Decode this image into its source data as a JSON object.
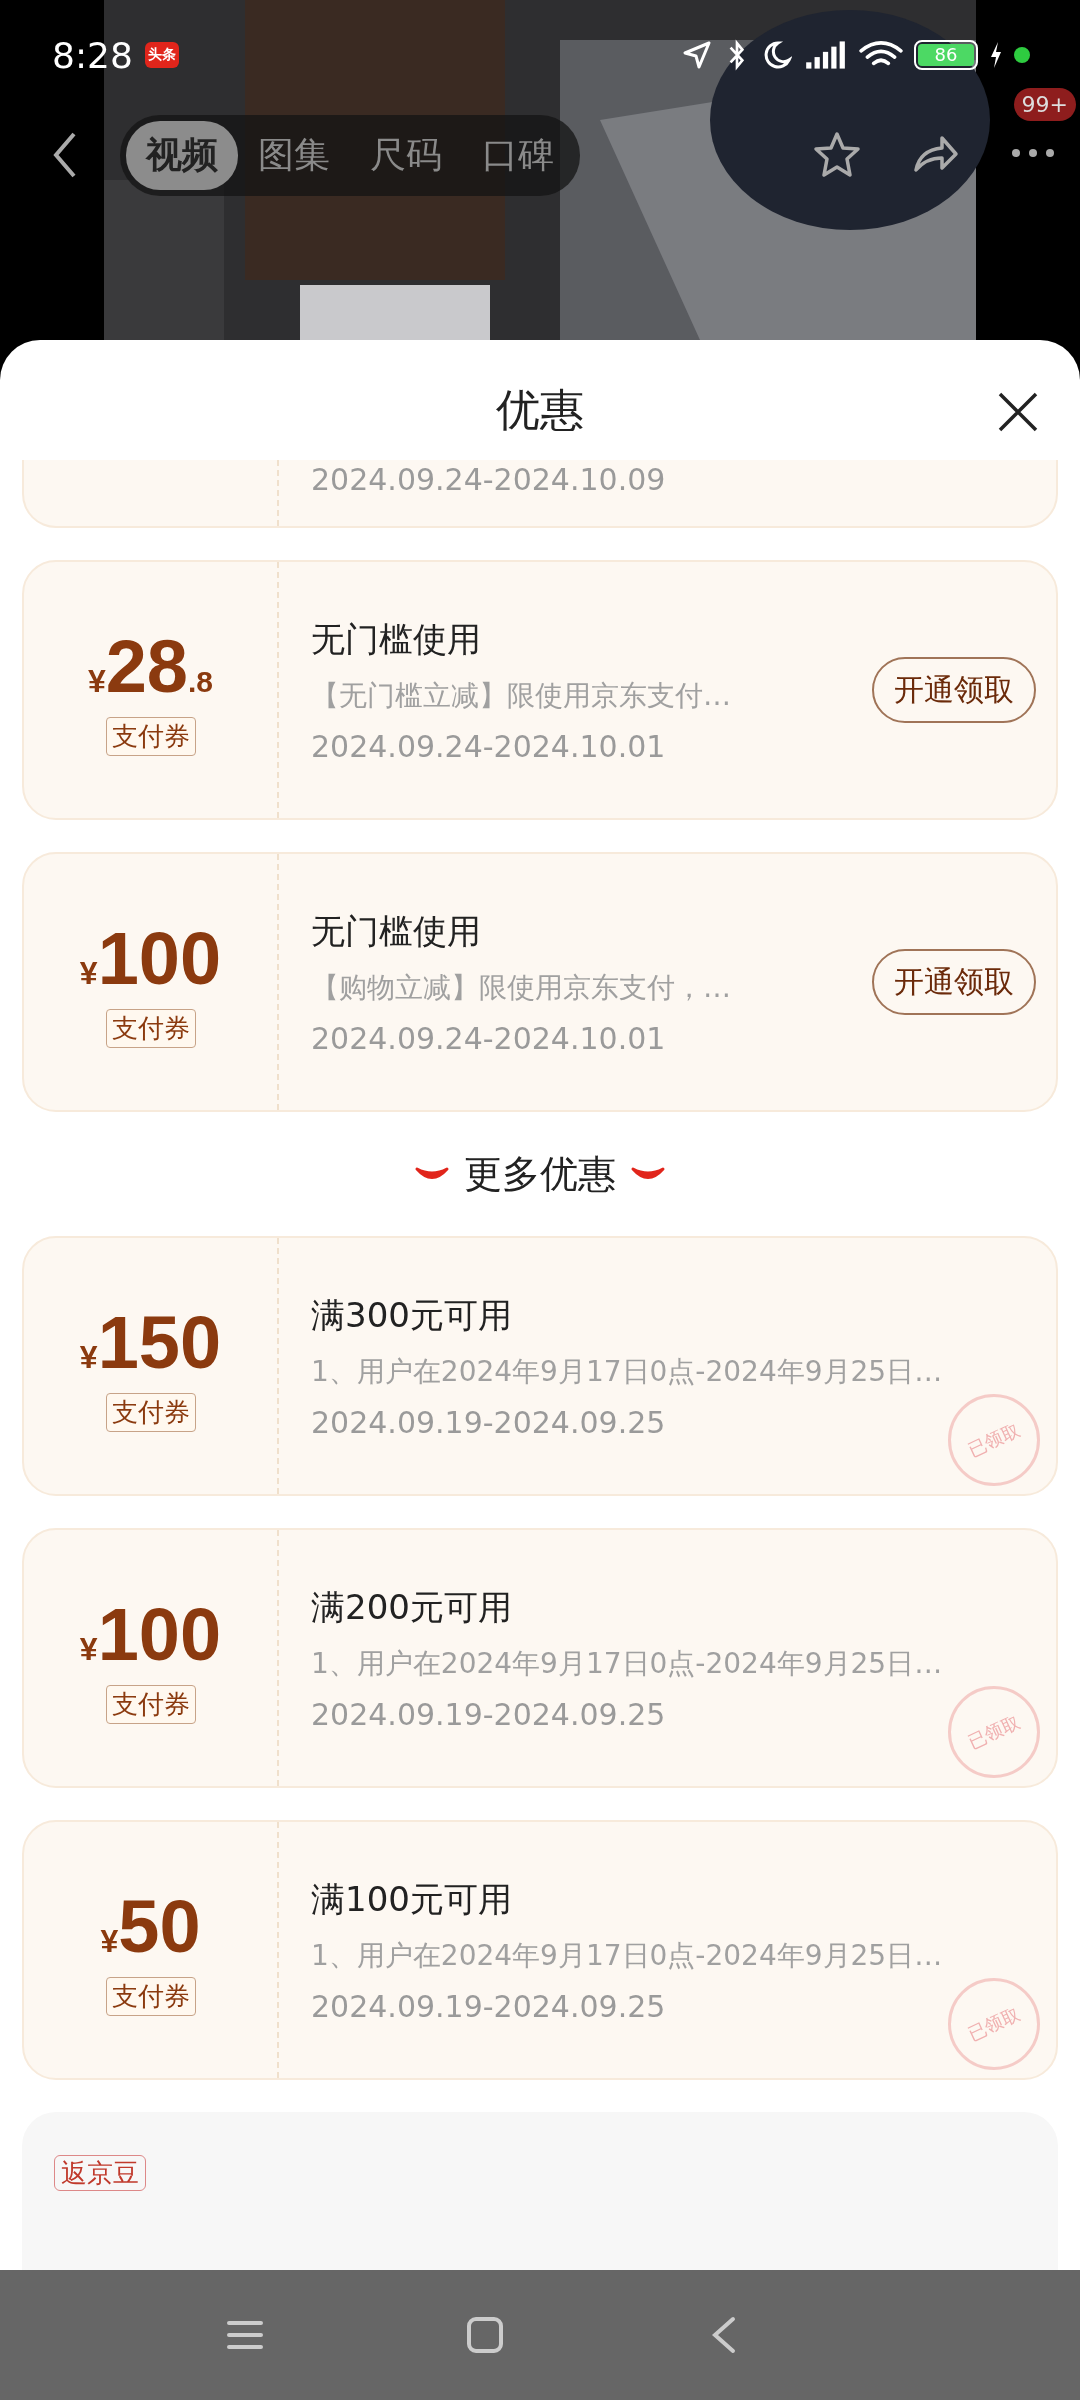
{
  "status_bar": {
    "time": "8:28",
    "app_badge": "头条",
    "battery": "86"
  },
  "nav": {
    "tabs": [
      {
        "label": "视频",
        "selected": true
      },
      {
        "label": "图集",
        "selected": false
      },
      {
        "label": "尺码",
        "selected": false
      },
      {
        "label": "口碑",
        "selected": false
      }
    ],
    "badge": "99+"
  },
  "sheet": {
    "title": "优惠"
  },
  "coupons": [
    {
      "kind": "stub",
      "date": "2024.09.24-2024.10.09"
    },
    {
      "kind": "full",
      "currency": "¥",
      "amount": "28",
      "decimal": ".8",
      "tag": "支付券",
      "title": "无门槛使用",
      "desc": "【无门槛立减】限使用京东支付…",
      "date": "2024.09.24-2024.10.01",
      "button": "开通领取"
    },
    {
      "kind": "full",
      "currency": "¥",
      "amount": "100",
      "tag": "支付券",
      "title": "无门槛使用",
      "desc": "【购物立减】限使用京东支付，…",
      "date": "2024.09.24-2024.10.01",
      "button": "开通领取"
    }
  ],
  "more_title": "更多优惠",
  "more_coupons": [
    {
      "kind": "full",
      "currency": "¥",
      "amount": "150",
      "tag": "支付券",
      "title": "满300元可用",
      "desc": "1、用户在2024年9月17日0点-2024年9月25日…",
      "date": "2024.09.19-2024.09.25",
      "stamp": "已领取"
    },
    {
      "kind": "full",
      "currency": "¥",
      "amount": "100",
      "tag": "支付券",
      "title": "满200元可用",
      "desc": "1、用户在2024年9月17日0点-2024年9月25日…",
      "date": "2024.09.19-2024.09.25",
      "stamp": "已领取"
    },
    {
      "kind": "full",
      "currency": "¥",
      "amount": "50",
      "tag": "支付券",
      "title": "满100元可用",
      "desc": "1、用户在2024年9月17日0点-2024年9月25日…",
      "date": "2024.09.19-2024.09.25",
      "stamp": "已领取"
    }
  ],
  "bean_section": {
    "tag": "返京豆"
  }
}
